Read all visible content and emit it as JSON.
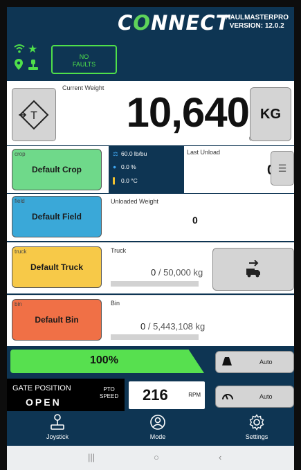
{
  "header": {
    "logo_pre": "C",
    "logo_o": "O",
    "logo_post": "NNECT",
    "app_name": "HAULMASTERPRO",
    "version": "VERSION: 12.0.2"
  },
  "status": {
    "faults_line1": "NO",
    "faults_line2": "FAULTS",
    "icons": [
      "wifi-icon",
      "star-icon",
      "location-pin-icon",
      "operator-icon"
    ],
    "accent_color": "#4fe04a"
  },
  "weight": {
    "label": "Current Weight",
    "value": "10,640",
    "sub_value": "0",
    "unit_button": "KG"
  },
  "crop": {
    "label": "crop",
    "name": "Default Crop",
    "color": "#6fd98a",
    "density": "60.0 lb/bu",
    "moisture": "0.0 %",
    "temperature": "0.0 °C",
    "last_unload_label": "Last Unload",
    "last_unload_value": "0"
  },
  "field": {
    "label": "field",
    "name": "Default Field",
    "color": "#3aa8d8",
    "unloaded_label": "Unloaded Weight",
    "unloaded_value": "0"
  },
  "truck": {
    "label": "truck",
    "name": "Default Truck",
    "color": "#f7c948",
    "title": "Truck",
    "current": "0",
    "capacity": "/ 50,000",
    "unit": "kg",
    "fill_fraction": 0
  },
  "bin": {
    "label": "bin",
    "name": "Default Bin",
    "color": "#f07046",
    "title": "Bin",
    "current": "0",
    "capacity": "/ 5,443,108",
    "unit": "kg",
    "fill_fraction": 0
  },
  "gate": {
    "percent": "100%",
    "position_label": "GATE POSITION",
    "position_value": "OPEN",
    "pto_line1": "PTO",
    "pto_line2": "SPEED",
    "rpm_value": "216",
    "rpm_unit": "RPM",
    "auto1": "Auto",
    "auto2": "Auto"
  },
  "nav": {
    "joystick": "Joystick",
    "mode": "Mode",
    "settings": "Settings"
  }
}
